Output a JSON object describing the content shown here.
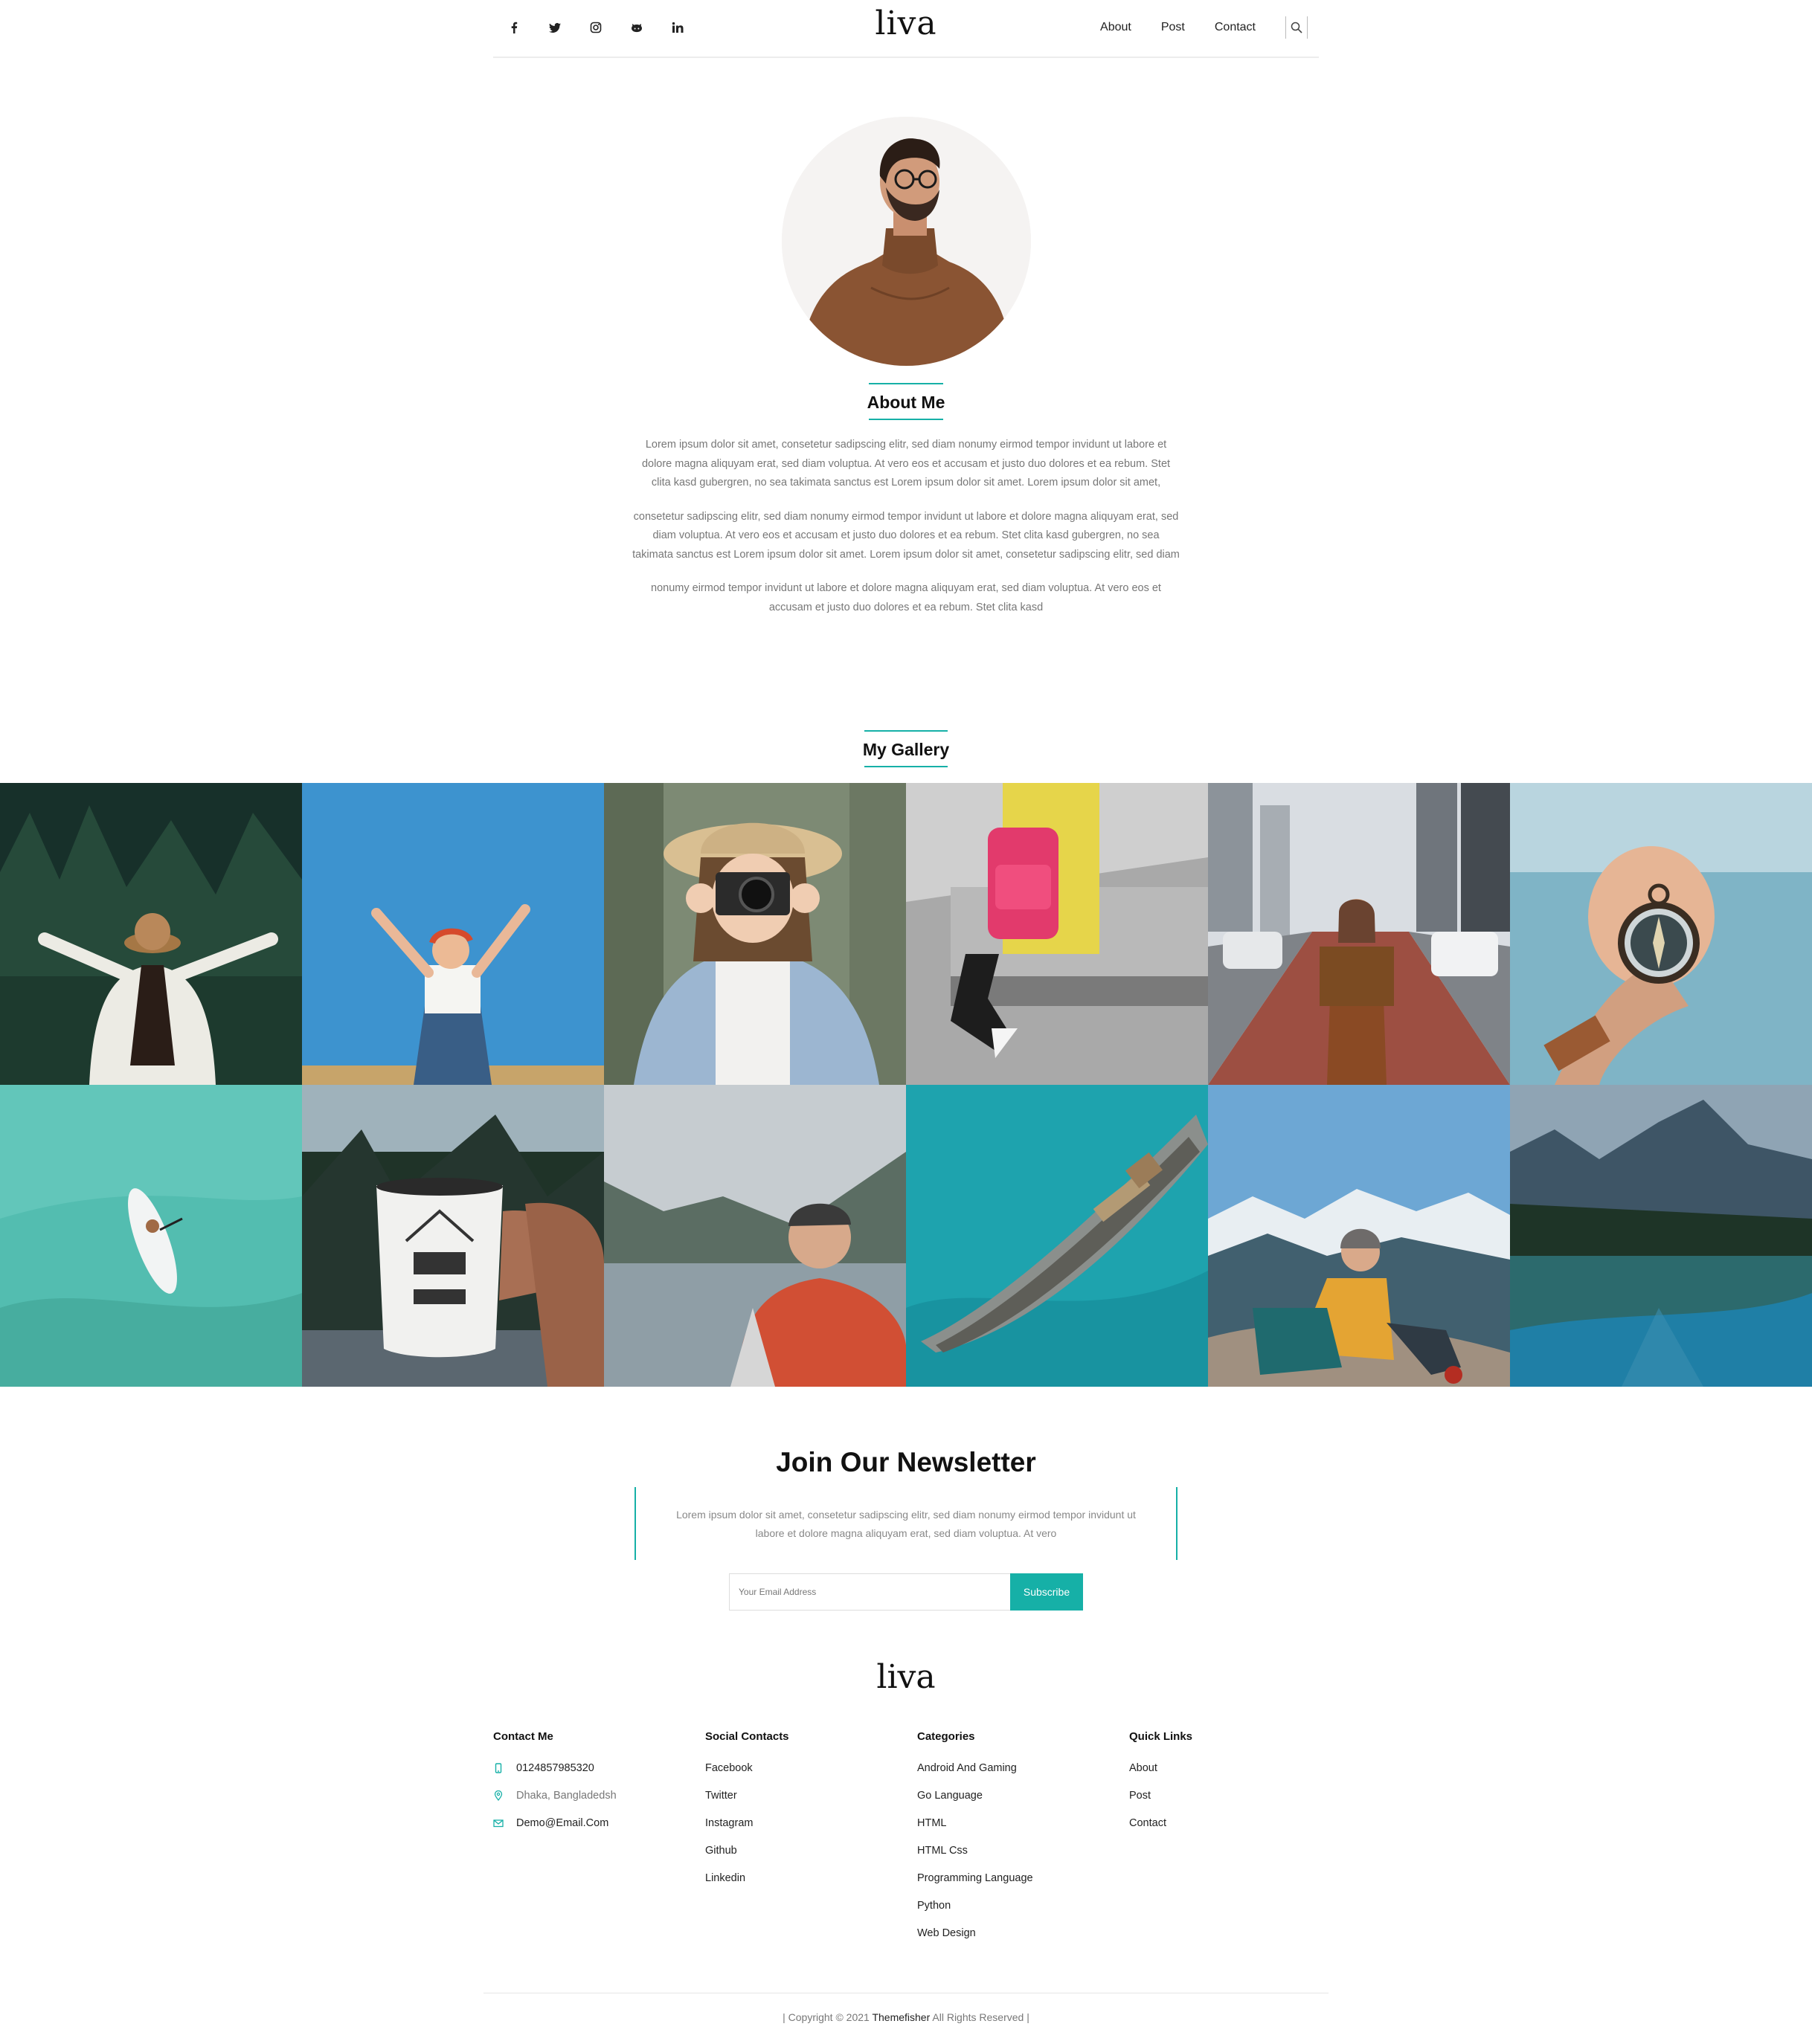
{
  "header": {
    "brand": "liva",
    "social_icons": [
      "facebook-icon",
      "twitter-icon",
      "instagram-icon",
      "github-icon",
      "linkedin-icon"
    ],
    "nav": [
      "About",
      "Post",
      "Contact"
    ],
    "search_icon": "search-icon"
  },
  "about": {
    "title": "About Me",
    "paragraphs": [
      "Lorem ipsum dolor sit amet, consetetur sadipscing elitr, sed diam nonumy eirmod tempor invidunt ut labore et dolore magna aliquyam erat, sed diam voluptua. At vero eos et accusam et justo duo dolores et ea rebum. Stet clita kasd gubergren, no sea takimata sanctus est Lorem ipsum dolor sit amet. Lorem ipsum dolor sit amet,",
      "consetetur sadipscing elitr, sed diam nonumy eirmod tempor invidunt ut labore et dolore magna aliquyam erat, sed diam voluptua. At vero eos et accusam et justo duo dolores et ea rebum. Stet clita kasd gubergren, no sea takimata sanctus est Lorem ipsum dolor sit amet. Lorem ipsum dolor sit amet, consetetur sadipscing elitr, sed diam",
      "nonumy eirmod tempor invidunt ut labore et dolore magna aliquyam erat, sed diam voluptua. At vero eos et accusam et justo duo dolores et ea rebum. Stet clita kasd"
    ]
  },
  "gallery": {
    "title": "My Gallery"
  },
  "newsletter": {
    "title": "Join Our Newsletter",
    "text": "Lorem ipsum dolor sit amet, consetetur sadipscing elitr, sed diam nonumy eirmod tempor invidunt ut labore et dolore magna aliquyam erat, sed diam voluptua. At vero",
    "placeholder": "Your Email Address",
    "button": "Subscribe"
  },
  "footer": {
    "brand": "liva",
    "contact": {
      "title": "Contact Me",
      "phone": "0124857985320",
      "address": "Dhaka, Bangladedsh",
      "email": "Demo@Email.Com"
    },
    "social": {
      "title": "Social Contacts",
      "items": [
        "Facebook",
        "Twitter",
        "Instagram",
        "Github",
        "Linkedin"
      ]
    },
    "categories": {
      "title": "Categories",
      "items": [
        "Android And Gaming",
        "Go Language",
        "HTML",
        "HTML Css",
        "Programming Language",
        "Python",
        "Web Design"
      ]
    },
    "quick": {
      "title": "Quick Links",
      "items": [
        "About",
        "Post",
        "Contact"
      ]
    },
    "copyright_prefix": "| Copyright © 2021 ",
    "copyright_brand": "Themefisher",
    "copyright_suffix": " All Rights Reserved |"
  },
  "colors": {
    "accent": "#16b0a7",
    "text": "#222222",
    "muted": "#777777"
  }
}
